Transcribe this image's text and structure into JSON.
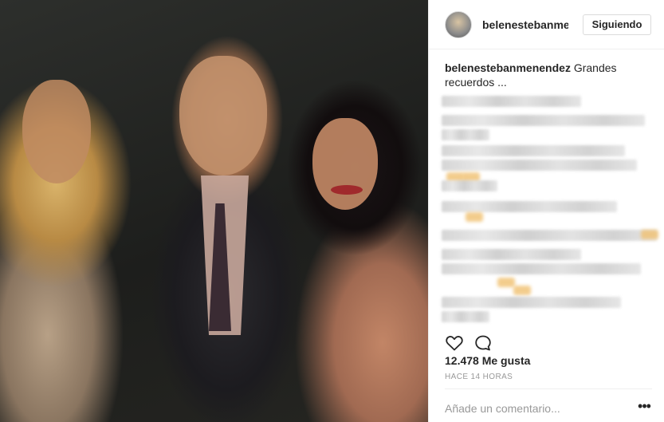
{
  "post": {
    "username": "belenestebanmenendez",
    "follow_label": "Siguiendo",
    "caption_user": "belenestebanmenendez",
    "caption_text": " Grandes recuerdos ...",
    "likes": "12.478 Me gusta",
    "time": "HACE 14 HORAS",
    "comment_placeholder": "Añade un comentario...",
    "more_icon": "•••"
  },
  "icons": {
    "like": "heart-icon",
    "comment": "comment-icon",
    "more": "more-options-icon"
  },
  "colors": {
    "text": "#262626",
    "muted": "#999999",
    "border": "#dbdbdb"
  }
}
